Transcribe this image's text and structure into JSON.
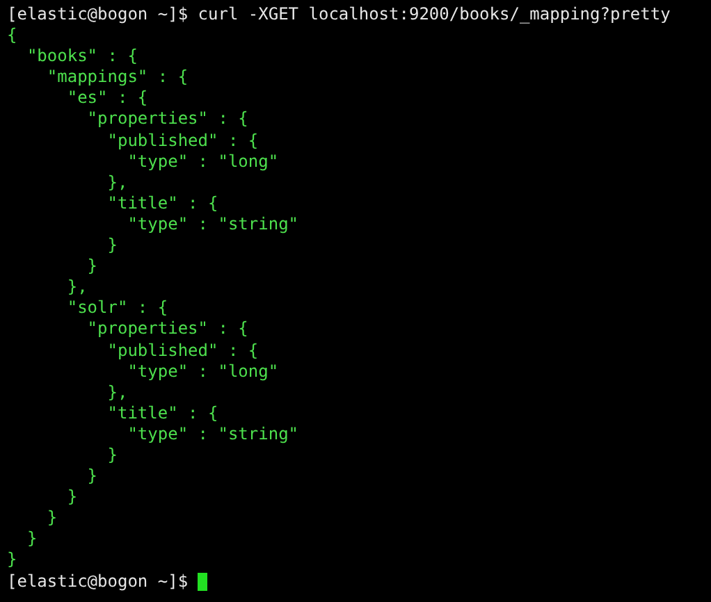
{
  "terminal": {
    "lines": [
      {
        "kind": "prompt",
        "text": "[elastic@bogon ~]$ curl -XGET localhost:9200/books/_mapping?pretty",
        "cursor": false
      },
      {
        "kind": "output",
        "text": "{"
      },
      {
        "kind": "output",
        "text": "  \"books\" : {"
      },
      {
        "kind": "output",
        "text": "    \"mappings\" : {"
      },
      {
        "kind": "output",
        "text": "      \"es\" : {"
      },
      {
        "kind": "output",
        "text": "        \"properties\" : {"
      },
      {
        "kind": "output",
        "text": "          \"published\" : {"
      },
      {
        "kind": "output",
        "text": "            \"type\" : \"long\""
      },
      {
        "kind": "output",
        "text": "          },"
      },
      {
        "kind": "output",
        "text": "          \"title\" : {"
      },
      {
        "kind": "output",
        "text": "            \"type\" : \"string\""
      },
      {
        "kind": "output",
        "text": "          }"
      },
      {
        "kind": "output",
        "text": "        }"
      },
      {
        "kind": "output",
        "text": "      },"
      },
      {
        "kind": "output",
        "text": "      \"solr\" : {"
      },
      {
        "kind": "output",
        "text": "        \"properties\" : {"
      },
      {
        "kind": "output",
        "text": "          \"published\" : {"
      },
      {
        "kind": "output",
        "text": "            \"type\" : \"long\""
      },
      {
        "kind": "output",
        "text": "          },"
      },
      {
        "kind": "output",
        "text": "          \"title\" : {"
      },
      {
        "kind": "output",
        "text": "            \"type\" : \"string\""
      },
      {
        "kind": "output",
        "text": "          }"
      },
      {
        "kind": "output",
        "text": "        }"
      },
      {
        "kind": "output",
        "text": "      }"
      },
      {
        "kind": "output",
        "text": "    }"
      },
      {
        "kind": "output",
        "text": "  }"
      },
      {
        "kind": "output",
        "text": "}"
      },
      {
        "kind": "prompt",
        "text": "[elastic@bogon ~]$",
        "cursor": true
      }
    ]
  }
}
